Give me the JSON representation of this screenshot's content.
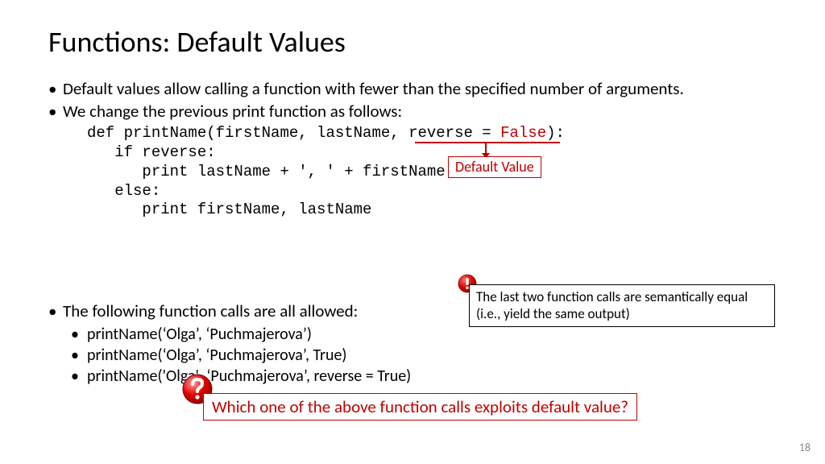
{
  "title": "Functions: Default Values",
  "bullets": {
    "b1": "Default values allow calling a function with fewer than the specified number of arguments.",
    "b2": "We change the previous print function as follows:",
    "b3": "The following function calls are all allowed:"
  },
  "code": {
    "l1a": "def printName(firstName, lastName, reverse = ",
    "l1b": "False",
    "l1c": "):",
    "l2": "   if reverse:",
    "l3": "      print lastName + ', ' + firstName",
    "l4": "   else:",
    "l5": "      print firstName, lastName"
  },
  "default_label": "Default Value",
  "calls": {
    "c1": "printName(‘Olga’, ‘Puchmajerova’)",
    "c2": "printName(‘Olga’, ‘Puchmajerova’, True)",
    "c3": "printName('Olga', ‘Puchmajerova’, reverse = True)"
  },
  "note": "The last two function calls are semantically equal (i.e., yield the same output)",
  "question": "Which one of the above function calls exploits default value?",
  "page": "18"
}
